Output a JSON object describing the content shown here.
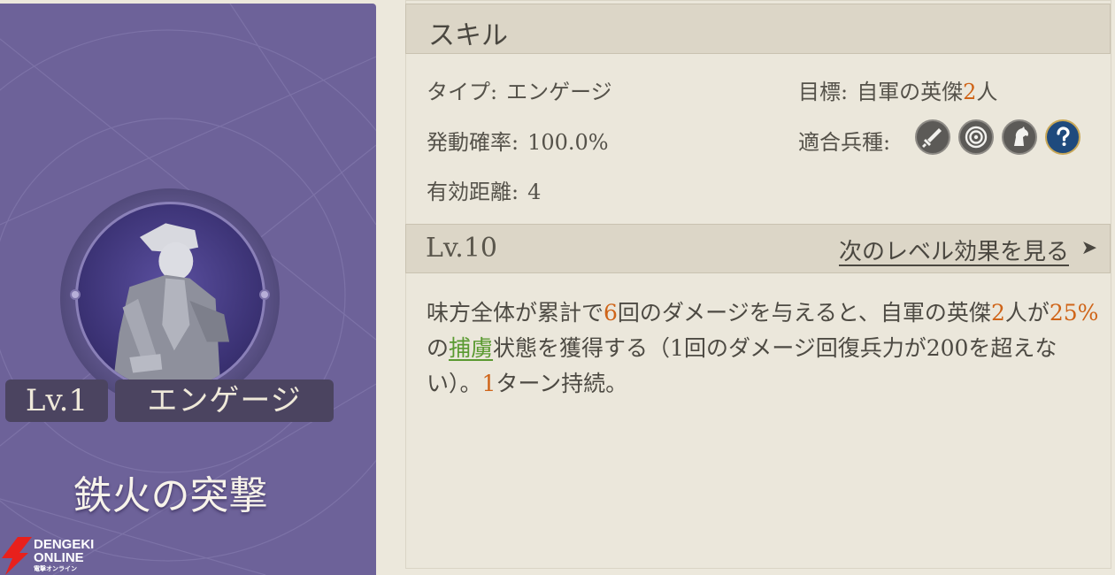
{
  "card": {
    "level_label": "Lv.1",
    "type_label": "エンゲージ",
    "skill_name": "鉄火の突撃"
  },
  "watermark": {
    "line1": "DENGEKI",
    "line2": "ONLINE",
    "line3": "電撃オンライン"
  },
  "skill_section": {
    "title": "スキル",
    "type_label": "タイプ:",
    "type_value": "エンゲージ",
    "rate_label": "発動確率:",
    "rate_value": "100.0%",
    "range_label": "有効距離:",
    "range_value": "4",
    "target_label": "目標:",
    "target_prefix": "自軍の英傑",
    "target_count": "2",
    "target_suffix": "人",
    "units_label": "適合兵種:",
    "unit_icons": [
      "sword-icon",
      "target-icon",
      "horse-icon",
      "question-icon"
    ]
  },
  "level_section": {
    "title": "Lv.10",
    "next_link": "次のレベル効果を見る",
    "arrow": "➤"
  },
  "description": {
    "p1": "味方全体が累計で",
    "n1": "6",
    "p2": "回のダメージを与えると、自軍の英傑",
    "n2": "2",
    "p3": "人が",
    "n3": "25%",
    "p4": "の",
    "status": "捕虜",
    "p5": "状態を獲得する（1回のダメージ回復兵力が200を超えない）。",
    "n4": "1",
    "p6": "ターン持続。"
  },
  "colors": {
    "card_bg": "#6d6299",
    "panel_bg": "#ebe7db",
    "header_bg": "#dcd6c7",
    "highlight_orange": "#cf6418",
    "highlight_green": "#5a9a31"
  }
}
